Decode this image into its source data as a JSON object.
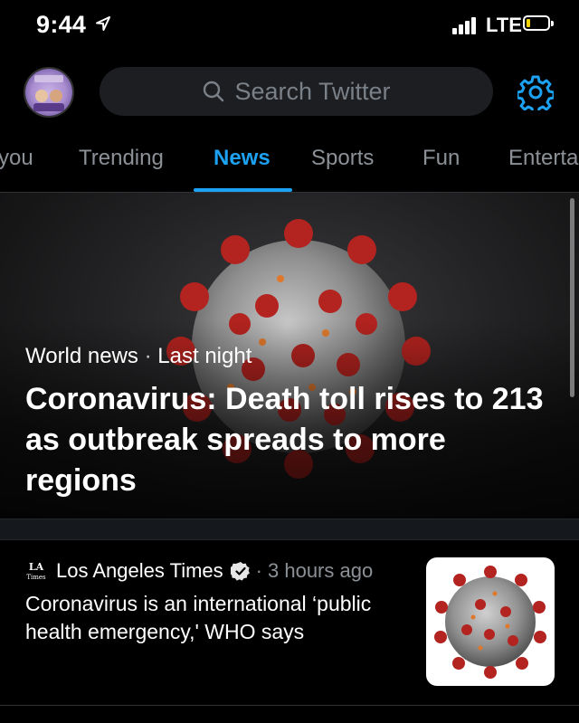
{
  "status_bar": {
    "time": "9:44",
    "carrier": "LTE",
    "battery_level_fraction": 0.1,
    "battery_color": "#f2d300"
  },
  "header": {
    "avatar": {
      "name": "avatar"
    },
    "search": {
      "placeholder": "Search Twitter",
      "icon": "search-icon"
    },
    "settings_icon": "gear-icon",
    "accent": "#1da1f2"
  },
  "tabs": [
    {
      "label": "you"
    },
    {
      "label": "Trending"
    },
    {
      "label": "News",
      "active": true
    },
    {
      "label": "Sports"
    },
    {
      "label": "Fun"
    },
    {
      "label": "Enterta"
    }
  ],
  "hero": {
    "category": "World news",
    "separator": "·",
    "time": "Last night",
    "title": "Coronavirus: Death toll rises to 213 as outbreak spreads to more regions"
  },
  "story": {
    "source": "Los Angeles Times",
    "verified": true,
    "separator": "·",
    "time": "3 hours ago",
    "title": "Coronavirus is an international ‘public health emergency,' WHO says"
  }
}
